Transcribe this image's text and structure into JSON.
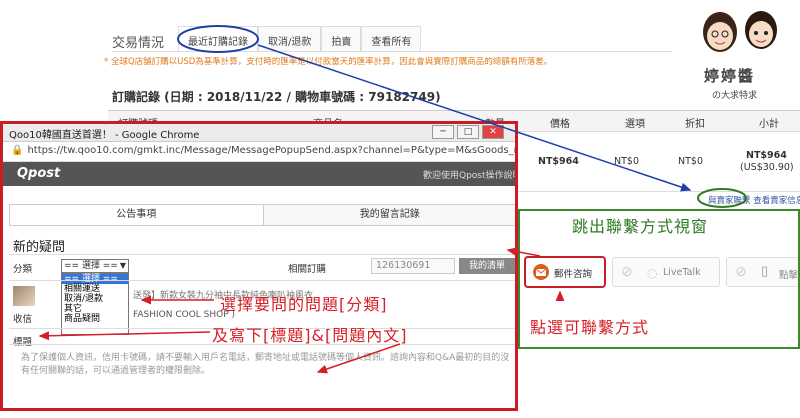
{
  "page": {
    "title": "交易情況",
    "tabs": [
      "最近訂購記錄",
      "取消/退款",
      "拍賣",
      "查看所有"
    ],
    "notice": "* 全球Q店舖訂購以USD為基準計算，支付時的匯率是以付款當天的匯率計算，因此會與實際訂購商品的總額有所落差。",
    "order_record": "訂購記錄 (日期 : 2018/11/22 / 購物車號碼 : 79182749)",
    "columns": [
      "訂購號碼",
      "商品名",
      "數量",
      "價格",
      "選項",
      "折扣",
      "小計"
    ],
    "row": {
      "price": "NT$964",
      "option": "NT$0",
      "discount": "NT$0",
      "subtotal": "NT$964",
      "subtotal_usd": "(US$30.90)"
    },
    "seller_links": "與賣家聯繫 查看賣家信息",
    "contact_buttons": [
      "郵件咨詢",
      "LiveTalk",
      "點擊"
    ],
    "brand": "婷婷醬",
    "brand_sub": "の大求特求"
  },
  "popup": {
    "window_title": "Qoo10韓國直送首選！ - Google Chrome",
    "url": "https://tw.qoo10.com/gmkt.inc/Message/MessagePopupSend.aspx?channel=P&type=M&sGoods_no...",
    "logo": "Qpost",
    "welcome": "歡迎使用Qpost操作說明",
    "tabs": [
      "公告事項",
      "我的留言記錄"
    ],
    "heading": "新的疑問",
    "category_label": "分類",
    "select_value": "== 選擇 ==",
    "options": [
      "== 選擇 ==",
      "相關運送",
      "取消/退款",
      "其它",
      "商品疑問"
    ],
    "order_label": "相關訂購",
    "order_value": "126130691",
    "order_button": "我的清單",
    "product_text": "送發】新款女裝九分袖中長款純色喇叭袖風衣",
    "receiver_label": "收信",
    "shop_text": "FASHION COOL SHOP )",
    "title_label": "標題",
    "privacy_text": "為了保護個人資訊，信用卡號碼，請不要輸入用戶名電話，郵寄地址或電話號碼等個人資訊。諮詢內容和Q&A最初的目的沒有任何關聯的話，可以通過管理者的權限刪除。"
  },
  "annotations": {
    "select_category": "選擇要問的問題[分類]",
    "write_title": "及寫下[標題]&[問題內文]",
    "popup_contact": "跳出聯繫方式視窗",
    "click_contact": "點選可聯繫方式"
  },
  "colors": {
    "annotation_red": "#d61f26",
    "annotation_green": "#2f7a22",
    "highlight_blue": "#1e3fa8",
    "notice_orange": "#e07a1a"
  }
}
